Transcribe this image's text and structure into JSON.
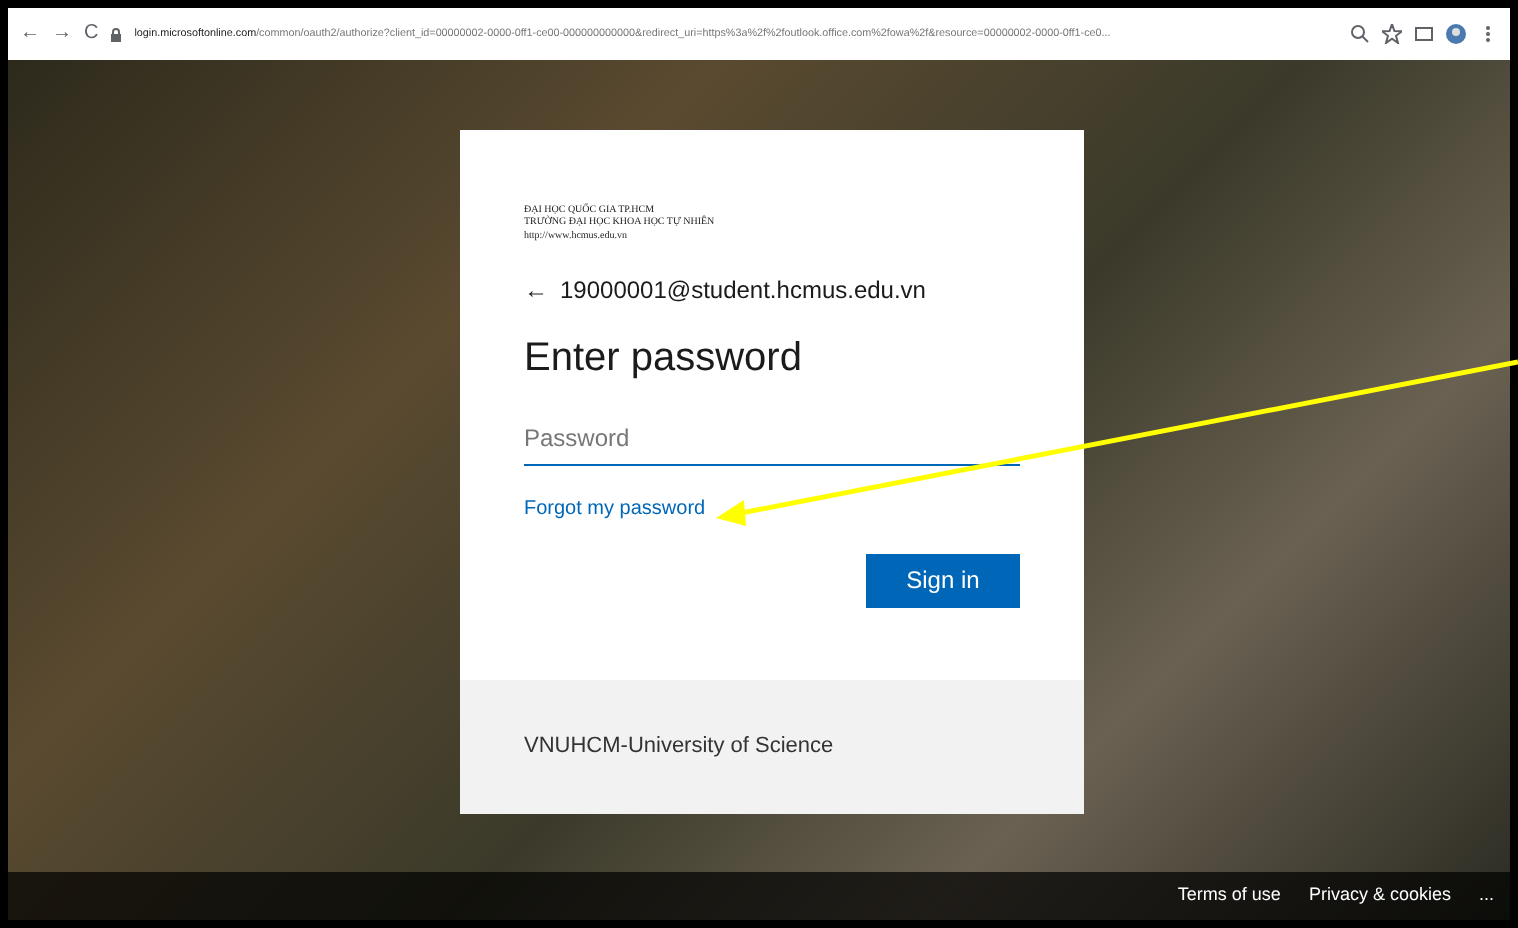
{
  "browser": {
    "back": "←",
    "forward": "→",
    "reload": "C",
    "url_host": "login.microsoftonline.com",
    "url_path": "/common/oauth2/authorize?client_id=00000002-0000-0ff1-ce00-000000000000&redirect_uri=https%3a%2f%2foutlook.office.com%2fowa%2f&resource=00000002-0000-0ff1-ce0..."
  },
  "logo": {
    "lines": [
      "ĐẠI HỌC QUỐC GIA TP.HCM",
      "TRƯỜNG ĐẠI HỌC KHOA HỌC TỰ NHIÊN",
      "http://www.hcmus.edu.vn"
    ]
  },
  "login": {
    "back": "←",
    "email": "19000001@student.hcmus.edu.vn",
    "heading": "Enter password",
    "password": {
      "placeholder": "Password"
    },
    "forgot": "Forgot my password",
    "sign_in": "Sign in"
  },
  "card_footer": "VNUHCM-University of Science",
  "footer": {
    "links": [
      "Terms of use",
      "Privacy & cookies"
    ],
    "more": "..."
  }
}
